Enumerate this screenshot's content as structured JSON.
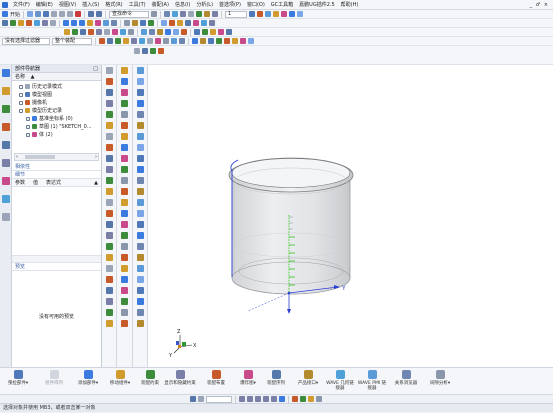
{
  "menubar": {
    "items": [
      "文件(F)",
      "编辑(E)",
      "视图(V)",
      "插入(S)",
      "格式(R)",
      "工具(T)",
      "装配(A)",
      "信息(I)",
      "分析(L)",
      "首选项(P)",
      "窗口(O)",
      "GC工具箱",
      "嘉鹏UG插件2.5",
      "帮助(H)"
    ],
    "right_controls": "_ ♂ ×"
  },
  "toolbar1": {
    "start_label": "开始",
    "cmd_finder": "查找命令",
    "layer_value": "1"
  },
  "toolbar3": {
    "filter_label": "没有选择过滤器",
    "scope_label": "整个装配"
  },
  "nav": {
    "title": "部件导航器",
    "col_name": "名称",
    "tree": [
      {
        "label": "历史记录模式",
        "indent": 1
      },
      {
        "label": "模型视图",
        "indent": 1
      },
      {
        "label": "摄像机",
        "indent": 1
      },
      {
        "label": "模型历史记录",
        "indent": 1
      },
      {
        "label": "基准坐标系 (0)",
        "indent": 2
      },
      {
        "label": "草图 (1) \"SKETCH_0...",
        "indent": 2
      },
      {
        "label": "体 (2)",
        "indent": 2
      }
    ],
    "section_dependency": "相依性",
    "section_details": "细节",
    "details_cols": [
      "参数",
      "值",
      "表达式"
    ],
    "section_preview": "预览",
    "preview_empty": "没有可用的预览"
  },
  "viewport": {
    "axis_x": "X",
    "axis_y": "Y",
    "axis_z": "Z",
    "colors": {
      "body": "#e2e3e6",
      "axis_blue": "#2a3fd6",
      "sketch_green": "#22c40a"
    }
  },
  "bottom_groups": [
    {
      "label": "曳拉部件",
      "arrow": "▾"
    },
    {
      "label": "组件阵列",
      "arrow": "",
      "disabled": true
    },
    {
      "label": "添加部件",
      "arrow": "▾"
    },
    {
      "label": "移动组件",
      "arrow": "▾"
    },
    {
      "label": "装配约束",
      "arrow": ""
    },
    {
      "label": "显示和隐藏约束",
      "arrow": ""
    },
    {
      "label": "装配布置",
      "arrow": ""
    },
    {
      "label": "爆炸图",
      "arrow": "▾"
    },
    {
      "label": "装配序列",
      "arrow": ""
    },
    {
      "label": "产品接口",
      "arrow": "▾"
    },
    {
      "label": "WAVE 几何链接器",
      "arrow": ""
    },
    {
      "label": "WAVE PMI 链接器",
      "arrow": ""
    },
    {
      "label": "关系浏览器",
      "arrow": ""
    },
    {
      "label": "间隙分析",
      "arrow": "▾"
    }
  ],
  "statusbar": {
    "text": "选择对象并使用 MB3，或者双击某一对象"
  }
}
